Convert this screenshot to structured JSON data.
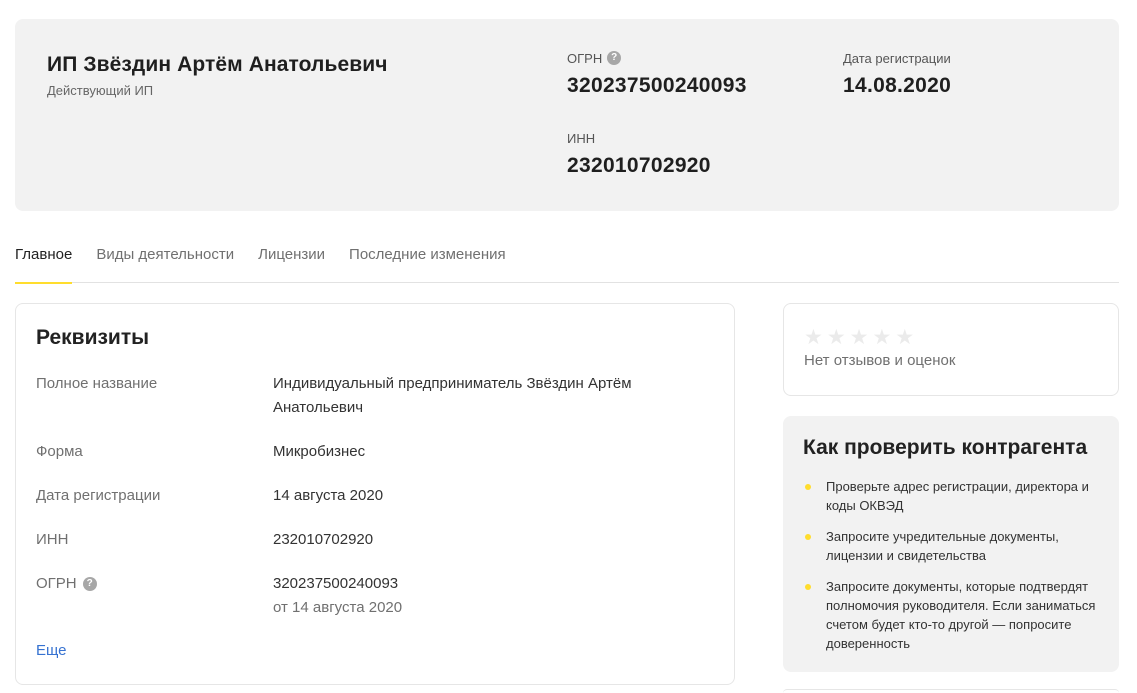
{
  "header": {
    "company_name": "ИП Звёздин Артём Анатольевич",
    "status": "Действующий ИП",
    "ogrn_label": "ОГРН",
    "ogrn_value": "320237500240093",
    "reg_date_label": "Дата регистрации",
    "reg_date_value": "14.08.2020",
    "inn_label": "ИНН",
    "inn_value": "232010702920"
  },
  "tabs": [
    {
      "label": "Главное",
      "active": true
    },
    {
      "label": "Виды деятельности",
      "active": false
    },
    {
      "label": "Лицензии",
      "active": false
    },
    {
      "label": "Последние изменения",
      "active": false
    }
  ],
  "requisites": {
    "title": "Реквизиты",
    "rows": [
      {
        "label": "Полное название",
        "value": "Индивидуальный предприниматель Звёздин Артём Анатольевич"
      },
      {
        "label": "Форма",
        "value": "Микробизнес"
      },
      {
        "label": "Дата регистрации",
        "value": "14 августа 2020"
      },
      {
        "label": "ИНН",
        "value": "232010702920"
      },
      {
        "label": "ОГРН",
        "value": "320237500240093",
        "sub": "от 14 августа 2020"
      }
    ],
    "more_link": "Еще"
  },
  "rating": {
    "stars_filled": 0,
    "stars_total": 5,
    "no_reviews_text": "Нет отзывов и оценок"
  },
  "check": {
    "title": "Как проверить контрагента",
    "items": [
      "Проверьте адрес регистрации, директора и коды ОКВЭД",
      "Запросите учредительные документы, лицензии и свидетельства",
      "Запросите документы, которые подтвердят полномочия руководителя. Если заниматься счетом будет кто-то другой — попросите доверенность"
    ]
  },
  "icons": {
    "help": "?",
    "star": "★"
  },
  "colors": {
    "accent_yellow": "#ffdd2d",
    "link_blue": "#3672d1",
    "header_bg": "#f2f2f2"
  }
}
